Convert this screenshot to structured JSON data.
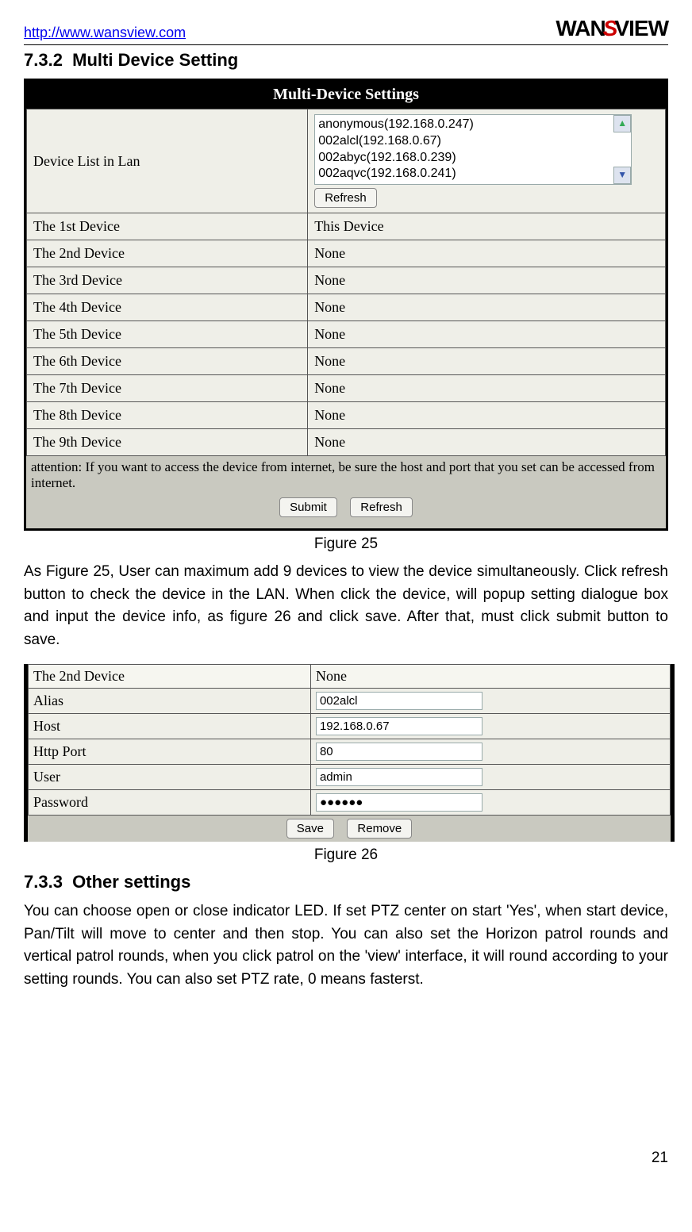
{
  "header": {
    "url": "http://www.wansview.com",
    "logo_pre": "WAN",
    "logo_swoosh": "S",
    "logo_post": "VIEW"
  },
  "section1": {
    "number": "7.3.2",
    "title": "Multi Device Setting"
  },
  "figure25": {
    "title": "Multi-Device Settings",
    "lan_label": "Device List in Lan",
    "lan_items": [
      "anonymous(192.168.0.247)",
      "002alcl(192.168.0.67)",
      "002abyc(192.168.0.239)",
      "002aqvc(192.168.0.241)"
    ],
    "refresh_btn": "Refresh",
    "rows": [
      {
        "label": "The 1st Device",
        "value": "This Device"
      },
      {
        "label": "The 2nd Device",
        "value": "None"
      },
      {
        "label": "The 3rd Device",
        "value": "None"
      },
      {
        "label": "The 4th Device",
        "value": "None"
      },
      {
        "label": "The 5th Device",
        "value": "None"
      },
      {
        "label": "The 6th Device",
        "value": "None"
      },
      {
        "label": "The 7th Device",
        "value": "None"
      },
      {
        "label": "The 8th Device",
        "value": "None"
      },
      {
        "label": "The 9th Device",
        "value": "None"
      }
    ],
    "attention": "attention: If you want to access the device from internet, be sure the host and port that you set can be accessed from internet.",
    "submit_btn": "Submit",
    "refresh_btn2": "Refresh",
    "caption": "Figure 25"
  },
  "paragraph1": "As Figure 25, User can maximum add 9 devices to view the device simultaneously. Click refresh button to check the device in the LAN. When click the device, will popup setting dialogue box and input the device info, as figure 26 and click save. After that, must click submit button to save.",
  "figure26": {
    "header_label": "The 2nd Device",
    "header_value": "None",
    "rows": [
      {
        "label": "Alias",
        "value": "002alcl"
      },
      {
        "label": "Host",
        "value": "192.168.0.67"
      },
      {
        "label": "Http Port",
        "value": "80"
      },
      {
        "label": "User",
        "value": "admin"
      },
      {
        "label": "Password",
        "value": "●●●●●●"
      }
    ],
    "save_btn": "Save",
    "remove_btn": "Remove",
    "caption": "Figure 26"
  },
  "section2": {
    "number": "7.3.3",
    "title": "Other settings"
  },
  "paragraph2": "You can choose open or close indicator LED. If set PTZ center on start 'Yes', when start device, Pan/Tilt will move to center and then stop. You can also set the Horizon patrol rounds and vertical patrol rounds, when you click patrol on the 'view' interface, it will round according to your setting rounds. You can also set PTZ rate, 0 means fasterst.",
  "page_number": "21"
}
